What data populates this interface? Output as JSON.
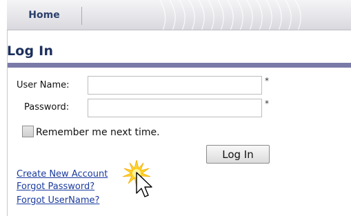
{
  "nav": {
    "home_tab": "Home"
  },
  "page": {
    "title": "Log In"
  },
  "form": {
    "username_label": "User Name:",
    "password_label": "Password:",
    "username_value": "",
    "password_value": "",
    "required_marker": "*",
    "remember_label": "Remember me next time.",
    "remember_checked": false,
    "submit_label": "Log In"
  },
  "links": {
    "create_account": "Create New Account",
    "forgot_password": "Forgot Password?",
    "forgot_username": "Forgot UserName?"
  },
  "icons": {
    "cursor": "arrow-pointer-icon",
    "click_highlight": "click-burst-icon"
  },
  "colors": {
    "title": "#1c2f5c",
    "rule": "#7a7aa8",
    "link": "#1a3a9e",
    "highlight": "#ffd21a"
  }
}
